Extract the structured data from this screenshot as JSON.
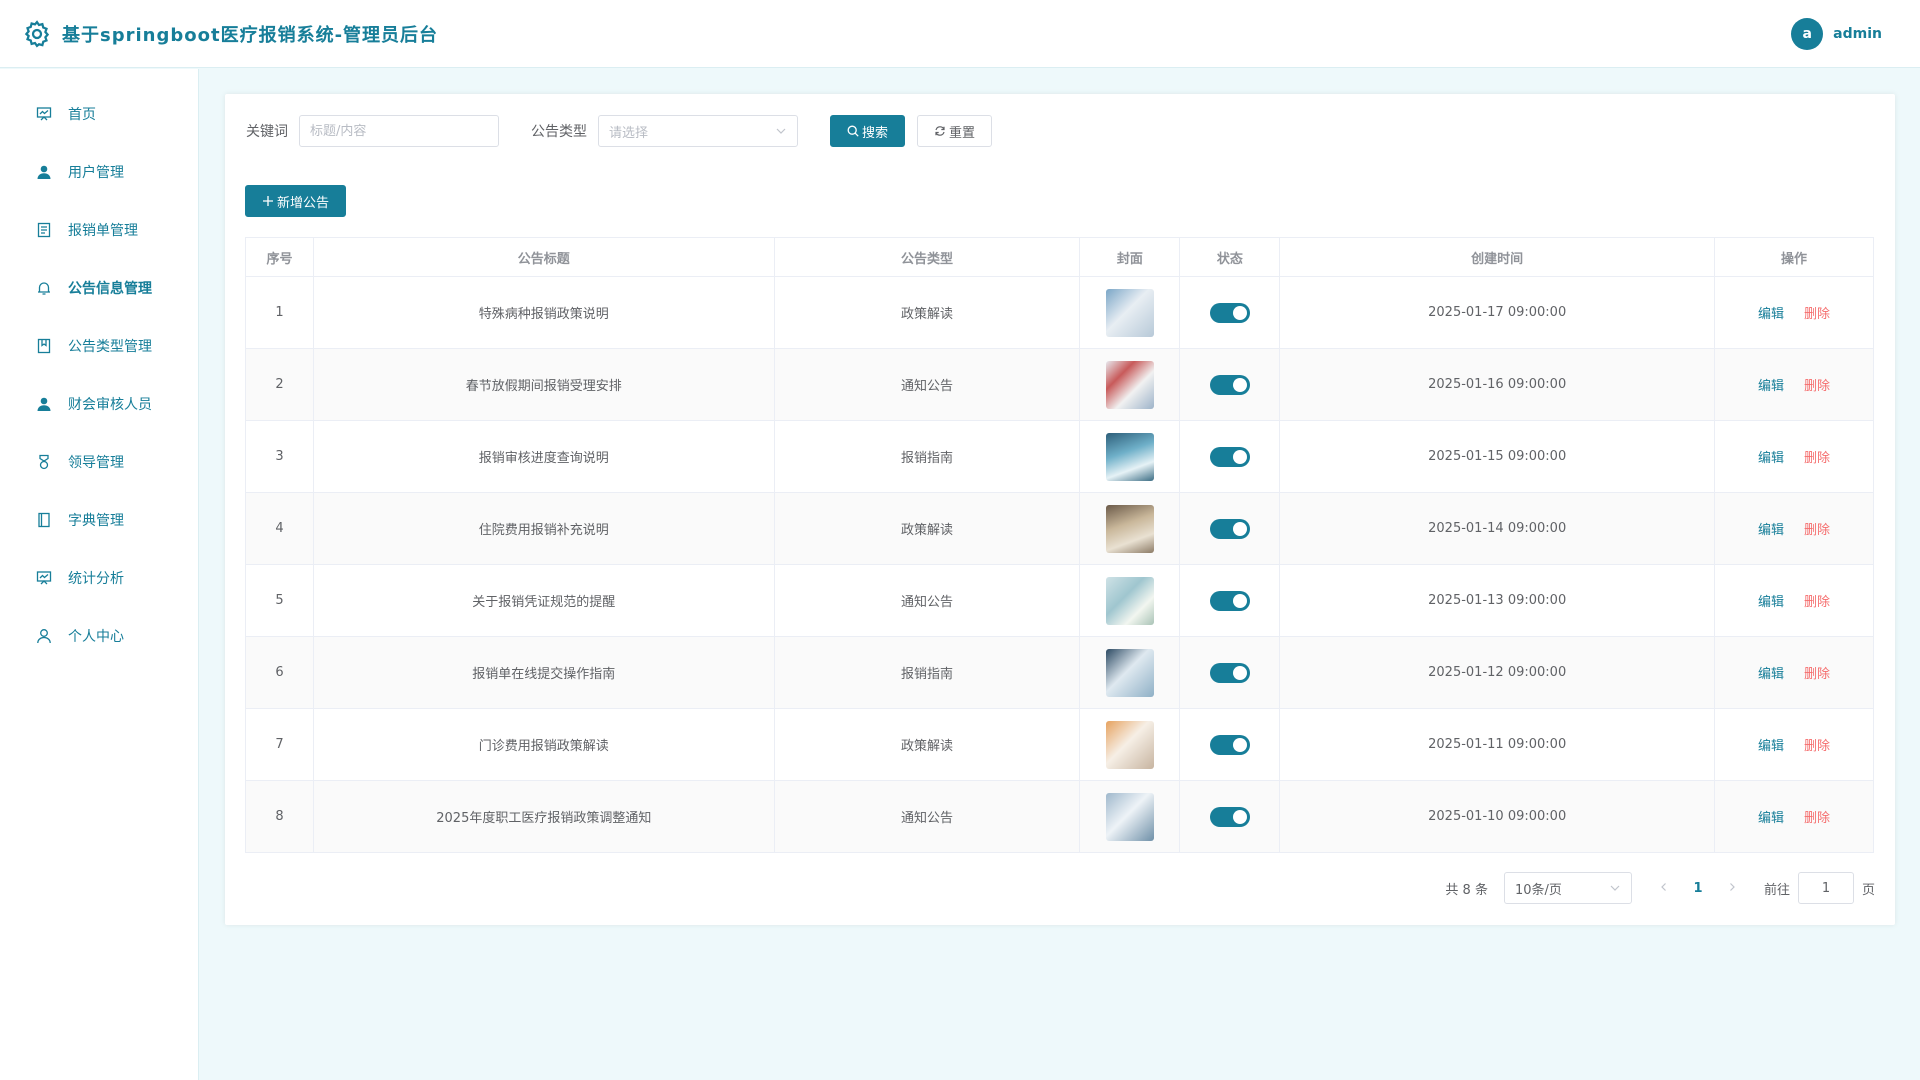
{
  "header": {
    "title": "基于springboot医疗报销系统-管理员后台",
    "user_initial": "a",
    "user_name": "admin"
  },
  "sidebar": {
    "items": [
      {
        "label": "首页",
        "icon": "dashboard-icon"
      },
      {
        "label": "用户管理",
        "icon": "user-icon"
      },
      {
        "label": "报销单管理",
        "icon": "document-icon"
      },
      {
        "label": "公告信息管理",
        "icon": "bell-icon",
        "active": true
      },
      {
        "label": "公告类型管理",
        "icon": "notebook-icon"
      },
      {
        "label": "财会审核人员",
        "icon": "user-icon"
      },
      {
        "label": "领导管理",
        "icon": "medal-icon"
      },
      {
        "label": "字典管理",
        "icon": "book-icon"
      },
      {
        "label": "统计分析",
        "icon": "chart-icon"
      },
      {
        "label": "个人中心",
        "icon": "person-outline-icon"
      }
    ]
  },
  "filters": {
    "keyword_label": "关键词",
    "keyword_placeholder": "标题/内容",
    "type_label": "公告类型",
    "type_placeholder": "请选择",
    "search_label": "搜索",
    "reset_label": "重置"
  },
  "add_button_label": "新增公告",
  "table": {
    "headers": [
      "序号",
      "公告标题",
      "公告类型",
      "封面",
      "状态",
      "创建时间",
      "操作"
    ],
    "edit_label": "编辑",
    "delete_label": "删除",
    "rows": [
      {
        "no": "1",
        "title": "特殊病种报销政策说明",
        "type": "政策解读",
        "created": "2025-01-17 09:00:00",
        "enabled": true
      },
      {
        "no": "2",
        "title": "春节放假期间报销受理安排",
        "type": "通知公告",
        "created": "2025-01-16 09:00:00",
        "enabled": true
      },
      {
        "no": "3",
        "title": "报销审核进度查询说明",
        "type": "报销指南",
        "created": "2025-01-15 09:00:00",
        "enabled": true
      },
      {
        "no": "4",
        "title": "住院费用报销补充说明",
        "type": "政策解读",
        "created": "2025-01-14 09:00:00",
        "enabled": true
      },
      {
        "no": "5",
        "title": "关于报销凭证规范的提醒",
        "type": "通知公告",
        "created": "2025-01-13 09:00:00",
        "enabled": true
      },
      {
        "no": "6",
        "title": "报销单在线提交操作指南",
        "type": "报销指南",
        "created": "2025-01-12 09:00:00",
        "enabled": true
      },
      {
        "no": "7",
        "title": "门诊费用报销政策解读",
        "type": "政策解读",
        "created": "2025-01-11 09:00:00",
        "enabled": true
      },
      {
        "no": "8",
        "title": "2025年度职工医疗报销政策调整通知",
        "type": "通知公告",
        "created": "2025-01-10 09:00:00",
        "enabled": true
      }
    ]
  },
  "pagination": {
    "total_text": "共 8 条",
    "page_size": "10条/页",
    "current_page": "1",
    "goto_label": "前往",
    "goto_value": "1",
    "page_suffix": "页"
  },
  "colors": {
    "primary": "#177e99",
    "danger": "#f56c6c",
    "background": "#eef9fb"
  }
}
